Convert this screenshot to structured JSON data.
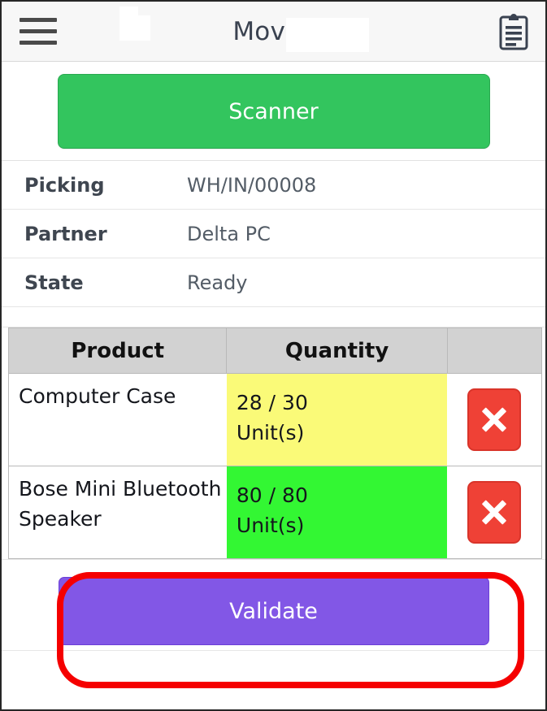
{
  "header": {
    "menu_icon": "hamburger-menu-icon",
    "title": "Moves",
    "action_icon": "clipboard-icon"
  },
  "scanner": {
    "label": "Scanner",
    "color": "#33c55e"
  },
  "info": [
    {
      "label": "Picking",
      "value": "WH/IN/00008"
    },
    {
      "label": "Partner",
      "value": "Delta PC"
    },
    {
      "label": "State",
      "value": "Ready"
    }
  ],
  "table": {
    "columns": [
      "Product",
      "Quantity",
      ""
    ],
    "rows": [
      {
        "product": "Computer Case",
        "quantity": "28 / 30\nUnit(s)",
        "quantity_done": 28,
        "quantity_total": 30,
        "uom": "Unit(s)",
        "status_color": "#fafa78",
        "delete_icon": "close-x-icon"
      },
      {
        "product": "Bose Mini Bluetooth Speaker",
        "quantity": "80 / 80\nUnit(s)",
        "quantity_done": 80,
        "quantity_total": 80,
        "uom": "Unit(s)",
        "status_color": "#33f733",
        "delete_icon": "close-x-icon"
      }
    ]
  },
  "footer": {
    "validate_label": "Validate",
    "validate_color": "#8257e6",
    "highlight_color": "#f50000"
  }
}
